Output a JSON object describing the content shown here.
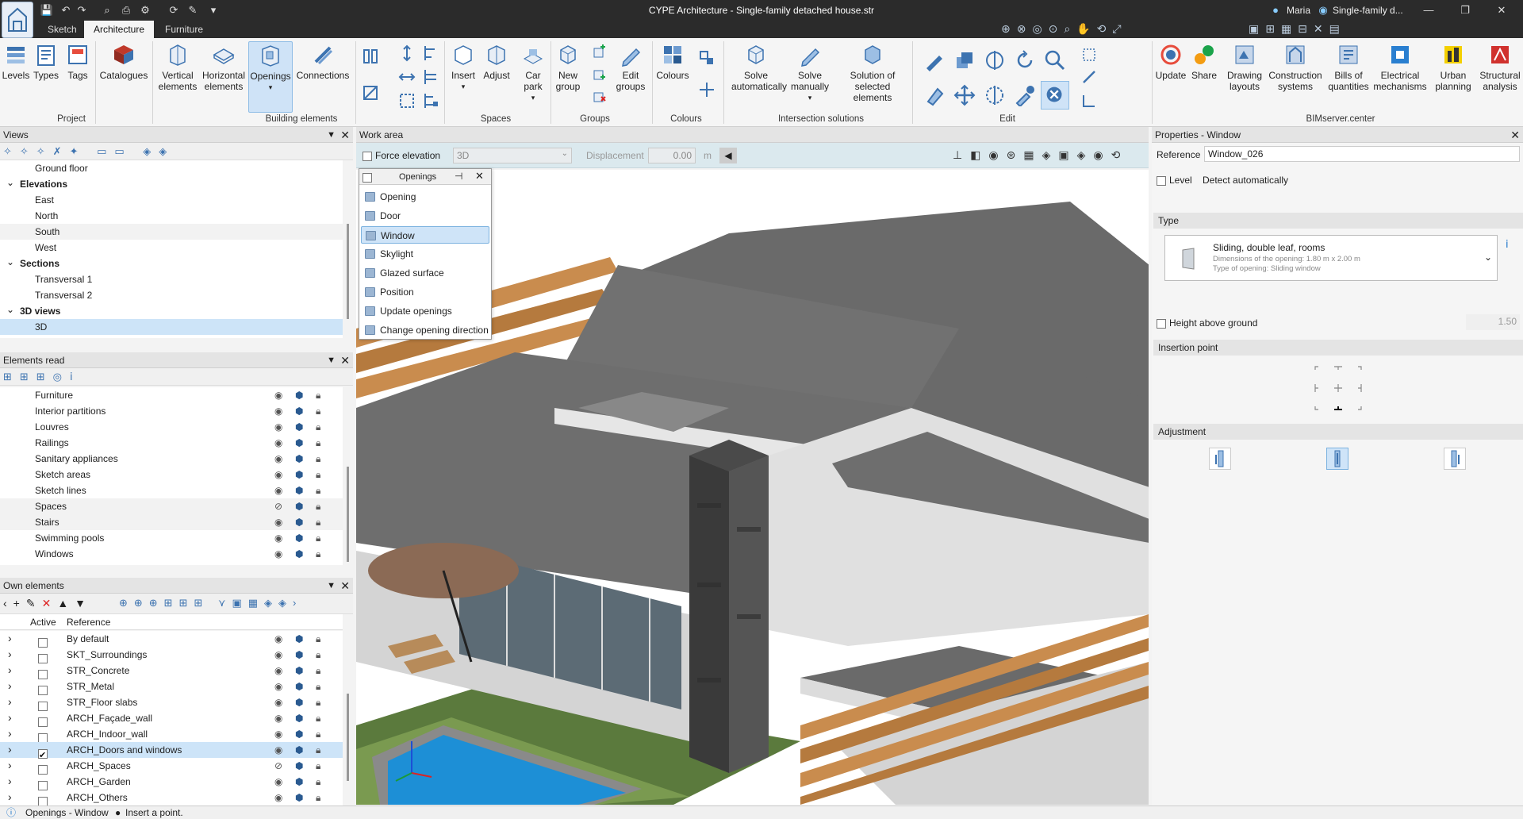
{
  "app": {
    "title": "CYPE Architecture - Single-family detached house.str",
    "user": "Maria",
    "project_short": "Single-family d..."
  },
  "tabs": [
    {
      "label": "Sketch"
    },
    {
      "label": "Architecture"
    },
    {
      "label": "Furniture"
    }
  ],
  "ribbon": {
    "project": {
      "levels": "Levels",
      "types": "Types",
      "tags": "Tags",
      "catalogues": "Catalogues",
      "group": "Project"
    },
    "building": {
      "vertical": "Vertical elements",
      "horizontal": "Horizontal elements",
      "openings": "Openings",
      "connections": "Connections",
      "group": "Building elements"
    },
    "spaces": {
      "insert": "Insert",
      "adjust": "Adjust",
      "carpark": "Car park",
      "group": "Spaces"
    },
    "groups": {
      "newgroup": "New group",
      "editgroups": "Edit groups",
      "group": "Groups"
    },
    "colours": {
      "colours": "Colours",
      "group": "Colours"
    },
    "intersection": {
      "auto": "Solve automatically",
      "manual": "Solve manually",
      "selected": "Solution of selected elements",
      "group": "Intersection solutions"
    },
    "edit": {
      "group": "Edit"
    },
    "bim": {
      "update": "Update",
      "share": "Share",
      "drawing": "Drawing layouts",
      "construction": "Construction systems",
      "bills": "Bills of quantities",
      "electrical": "Electrical mechanisms",
      "urban": "Urban planning",
      "structural": "Structural analysis",
      "group": "BIMserver.center"
    }
  },
  "views": {
    "title": "Views",
    "items": [
      {
        "label": "Ground floor",
        "level": 2
      },
      {
        "label": "Elevations",
        "level": 1,
        "group": true
      },
      {
        "label": "East",
        "level": 2
      },
      {
        "label": "North",
        "level": 2
      },
      {
        "label": "South",
        "level": 2
      },
      {
        "label": "West",
        "level": 2
      },
      {
        "label": "Sections",
        "level": 1,
        "group": true
      },
      {
        "label": "Transversal 1",
        "level": 2
      },
      {
        "label": "Transversal 2",
        "level": 2
      },
      {
        "label": "3D views",
        "level": 1,
        "group": true
      },
      {
        "label": "3D",
        "level": 2,
        "selected": true
      }
    ]
  },
  "elements_read": {
    "title": "Elements read",
    "items": [
      "Furniture",
      "Interior partitions",
      "Louvres",
      "Railings",
      "Sanitary appliances",
      "Sketch areas",
      "Sketch lines",
      "Spaces",
      "Stairs",
      "Swimming pools",
      "Windows"
    ]
  },
  "own_elements": {
    "title": "Own elements",
    "col_active": "Active",
    "col_reference": "Reference",
    "rows": [
      {
        "ref": "By default",
        "active": false
      },
      {
        "ref": "SKT_Surroundings",
        "active": false
      },
      {
        "ref": "STR_Concrete",
        "active": false
      },
      {
        "ref": "STR_Metal",
        "active": false
      },
      {
        "ref": "STR_Floor slabs",
        "active": false
      },
      {
        "ref": "ARCH_Façade_wall",
        "active": false
      },
      {
        "ref": "ARCH_Indoor_wall",
        "active": false
      },
      {
        "ref": "ARCH_Doors and windows",
        "active": true
      },
      {
        "ref": "ARCH_Spaces",
        "active": false
      },
      {
        "ref": "ARCH_Garden",
        "active": false
      },
      {
        "ref": "ARCH_Others",
        "active": false
      }
    ]
  },
  "workarea": {
    "title": "Work area",
    "force_elevation": "Force elevation",
    "view_select": "3D",
    "displacement_label": "Displacement",
    "displacement_value": "0.00",
    "displacement_unit": "m"
  },
  "openings_menu": {
    "title": "Openings",
    "items": [
      "Opening",
      "Door",
      "Window",
      "Skylight",
      "Glazed surface",
      "Position",
      "Update openings",
      "Change opening direction"
    ],
    "selected": "Window"
  },
  "properties": {
    "title": "Properties - Window",
    "reference_label": "Reference",
    "reference_value": "Window_026",
    "level_label": "Level",
    "level_value": "Detect automatically",
    "type_label": "Type",
    "type_name": "Sliding, double leaf, rooms",
    "type_dims": "Dimensions of the opening: 1.80 m x 2.00 m",
    "type_kind": "Type of opening: Sliding window",
    "height_label": "Height above ground",
    "height_value": "1.50",
    "insertion_label": "Insertion point",
    "adjustment_label": "Adjustment"
  },
  "status": {
    "text": "Openings - Window",
    "hint": "Insert a point."
  },
  "colors": {
    "titlebar": "#2b2b2b",
    "selection": "#cde4f8",
    "accent": "#1a73c9"
  }
}
